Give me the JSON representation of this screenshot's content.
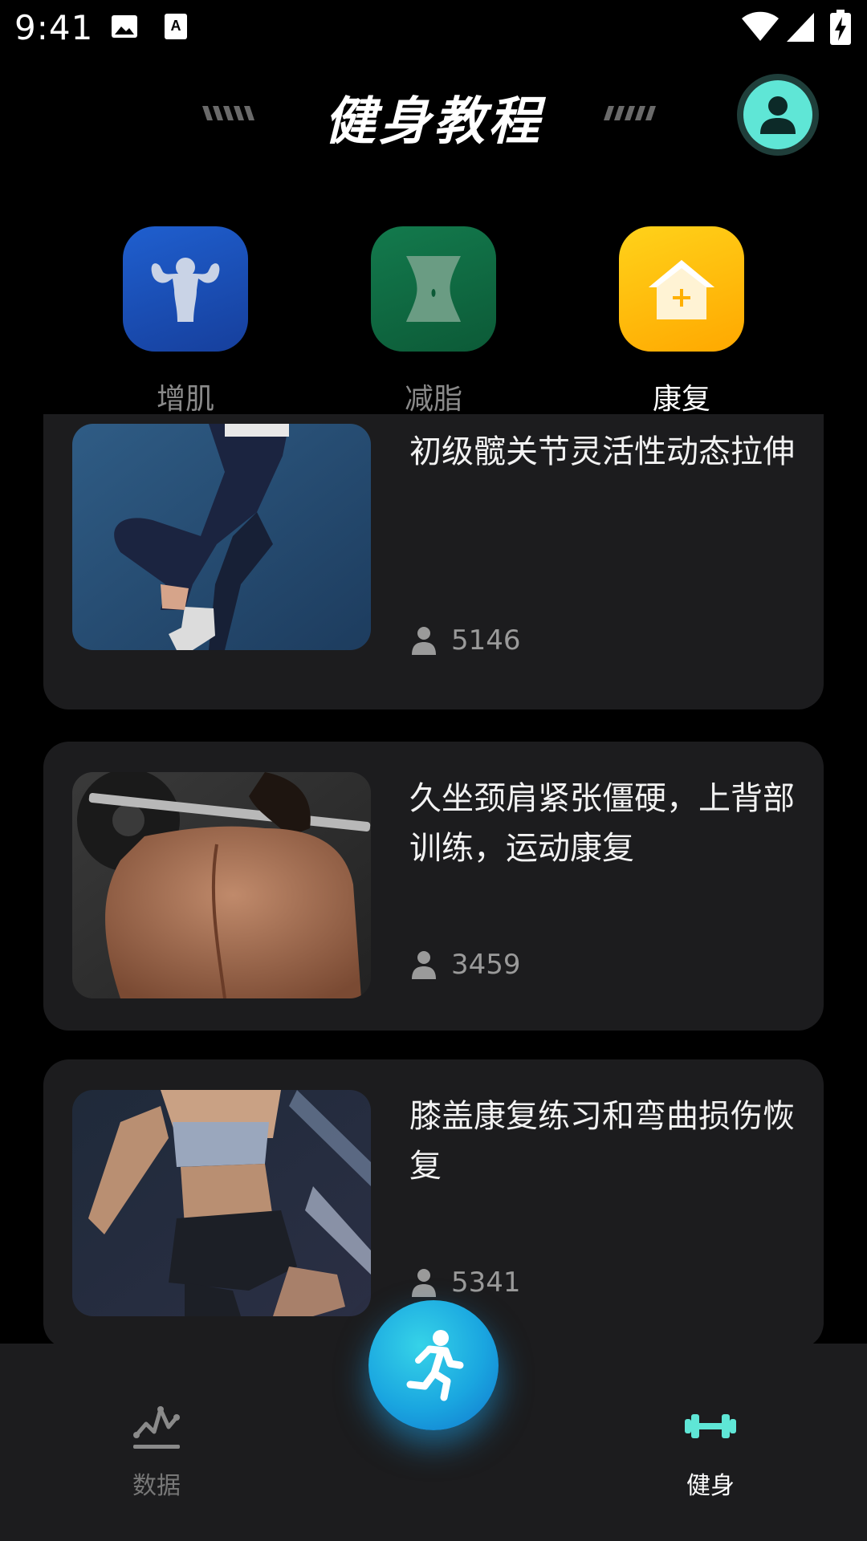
{
  "status_bar": {
    "time": "9:41",
    "icons": [
      "image-icon",
      "font-icon",
      "wifi-icon",
      "signal-icon",
      "battery-charging-icon"
    ]
  },
  "header": {
    "title": "健身教程",
    "avatar_icon": "user-icon",
    "accent_color": "#5fe6d6"
  },
  "categories": [
    {
      "label": "增肌",
      "icon": "muscle-icon",
      "color": "#1a4fb8",
      "active": false
    },
    {
      "label": "减脂",
      "icon": "waist-icon",
      "color": "#0f6b43",
      "active": false
    },
    {
      "label": "康复",
      "icon": "home-plus-icon",
      "color": "#ffb400",
      "active": true
    }
  ],
  "tutorials": [
    {
      "title": "初级髋关节灵活性动态拉伸",
      "count": "5146",
      "count_icon": "person-icon"
    },
    {
      "title": "久坐颈肩紧张僵硬，上背部训练，运动康复",
      "count": "3459",
      "count_icon": "person-icon"
    },
    {
      "title": "膝盖康复练习和弯曲损伤恢复",
      "count": "5341",
      "count_icon": "person-icon"
    }
  ],
  "bottom_nav": {
    "items": [
      {
        "label": "数据",
        "icon": "chart-line-icon",
        "active": false
      },
      {
        "label": "健身",
        "icon": "dumbbell-icon",
        "active": true
      }
    ],
    "fab_icon": "running-icon"
  }
}
